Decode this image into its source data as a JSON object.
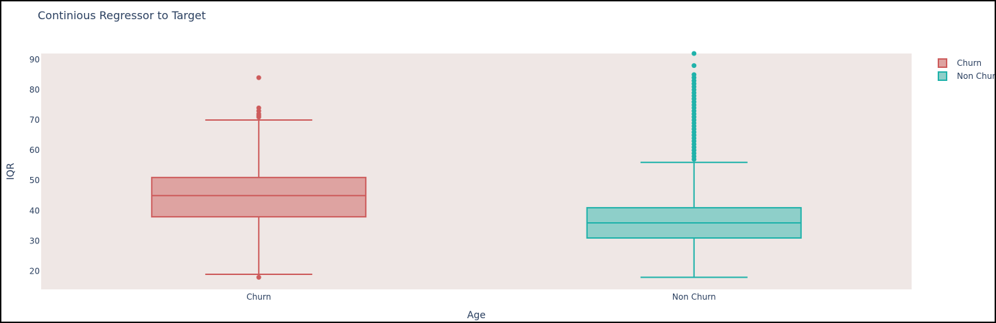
{
  "chart_data": {
    "type": "box",
    "title": "Continious Regressor to Target",
    "xlabel": "Age",
    "ylabel": "IQR",
    "categories": [
      "Churn",
      "Non Churn"
    ],
    "y_ticks": [
      20,
      30,
      40,
      50,
      60,
      70,
      80,
      90
    ],
    "ylim": [
      14,
      92
    ],
    "legend_position": "top-right",
    "plot_background": "#efe7e5",
    "series": [
      {
        "name": "Churn",
        "category": "Churn",
        "color": "#cd5c5c",
        "fill": "#dea3a1",
        "lower_whisker": 19,
        "q1": 38,
        "median": 45,
        "q3": 51,
        "upper_whisker": 70,
        "outliers": [
          84,
          74,
          73,
          72,
          71.5,
          71,
          18
        ]
      },
      {
        "name": "Non Churn",
        "category": "Non Churn",
        "color": "#20b2aa",
        "fill": "#8ecfc9",
        "lower_whisker": 18,
        "q1": 31,
        "median": 36,
        "q3": 41,
        "upper_whisker": 56,
        "outliers": [
          92,
          88,
          85,
          84,
          83,
          82,
          81,
          80,
          79,
          78,
          77,
          76,
          75,
          74,
          73,
          72,
          71,
          70,
          69,
          68,
          67,
          66,
          65,
          64,
          63,
          62,
          61,
          60,
          59,
          58,
          57
        ]
      }
    ]
  }
}
